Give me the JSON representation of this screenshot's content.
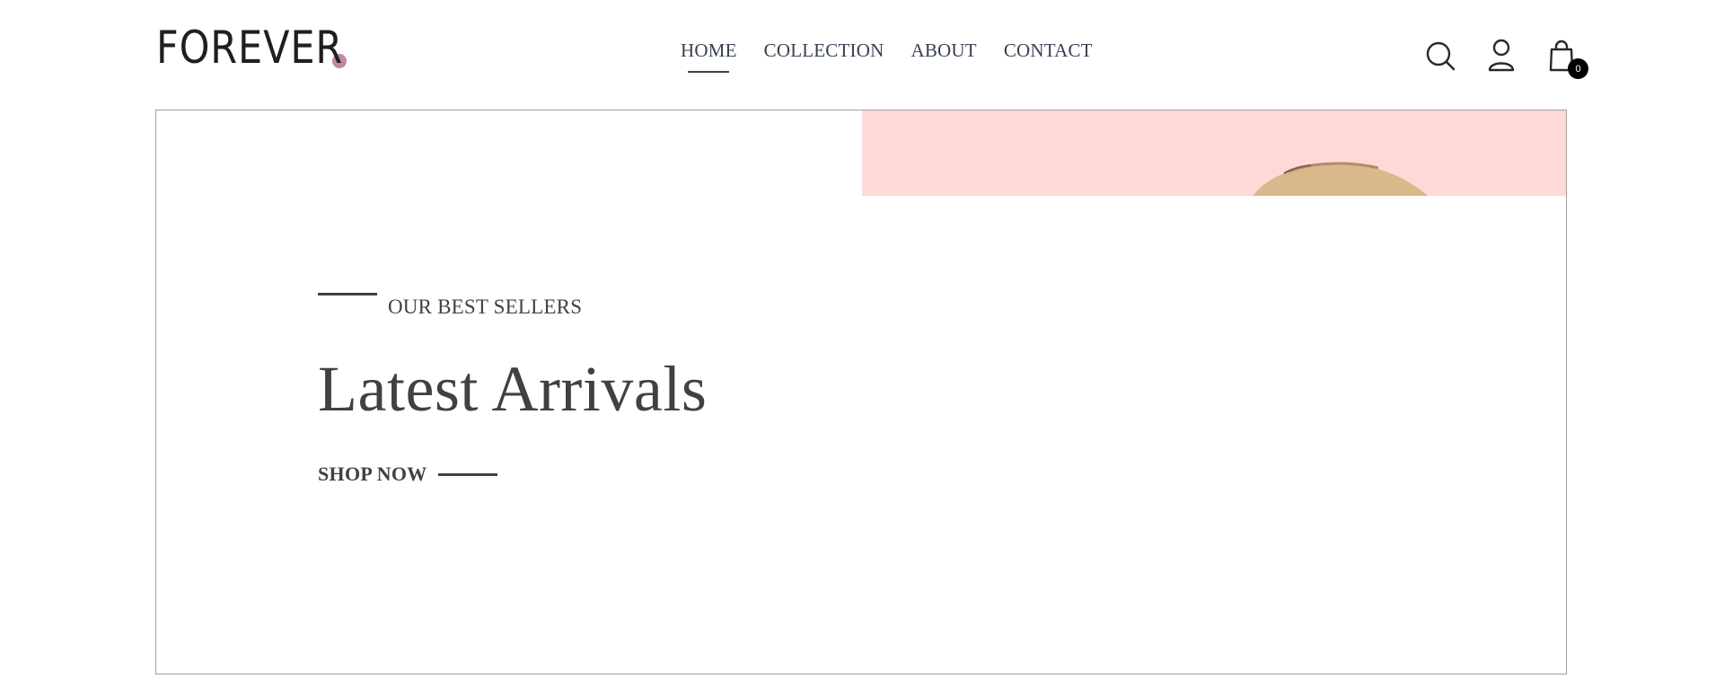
{
  "brand": {
    "name": "FOREVER",
    "dot_color": "#c586a5"
  },
  "nav": {
    "items": [
      {
        "label": "HOME",
        "active": true
      },
      {
        "label": "COLLECTION",
        "active": false
      },
      {
        "label": "ABOUT",
        "active": false
      },
      {
        "label": "CONTACT",
        "active": false
      }
    ]
  },
  "header_icons": {
    "search": "search-icon",
    "profile": "user-icon",
    "cart": "shopping-bag-icon",
    "cart_count": "0"
  },
  "hero": {
    "eyebrow": "OUR BEST SELLERS",
    "title": "Latest Arrivals",
    "cta": "SHOP NOW",
    "image_bg": "#ffd9d7"
  }
}
